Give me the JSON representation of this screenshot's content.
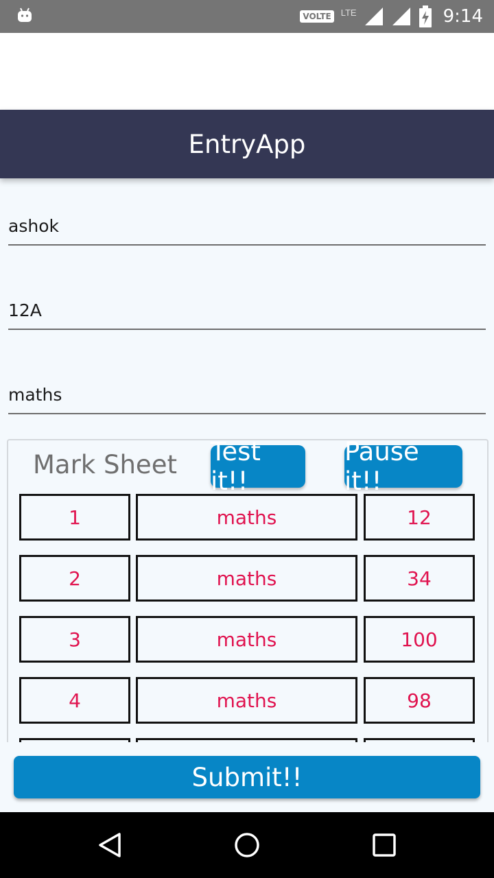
{
  "status_bar": {
    "volte": "VOLTE",
    "network": "LTE",
    "time": "9:14"
  },
  "app_bar": {
    "title": "EntryApp"
  },
  "form": {
    "name_value": "ashok",
    "class_value": "12A",
    "subject_value": "maths"
  },
  "mark_sheet": {
    "title": "Mark Sheet",
    "test_label": "Test it!!",
    "pause_label": "Pause it!!",
    "rows": [
      {
        "no": "1",
        "subject": "maths",
        "mark": "12"
      },
      {
        "no": "2",
        "subject": "maths",
        "mark": "34"
      },
      {
        "no": "3",
        "subject": "maths",
        "mark": "100"
      },
      {
        "no": "4",
        "subject": "maths",
        "mark": "98"
      },
      {
        "no": "",
        "subject": "",
        "mark": ""
      }
    ]
  },
  "submit_label": "Submit!!",
  "colors": {
    "app_bar": "#343754",
    "button": "#0786c6",
    "cell_text": "#e0134f"
  }
}
